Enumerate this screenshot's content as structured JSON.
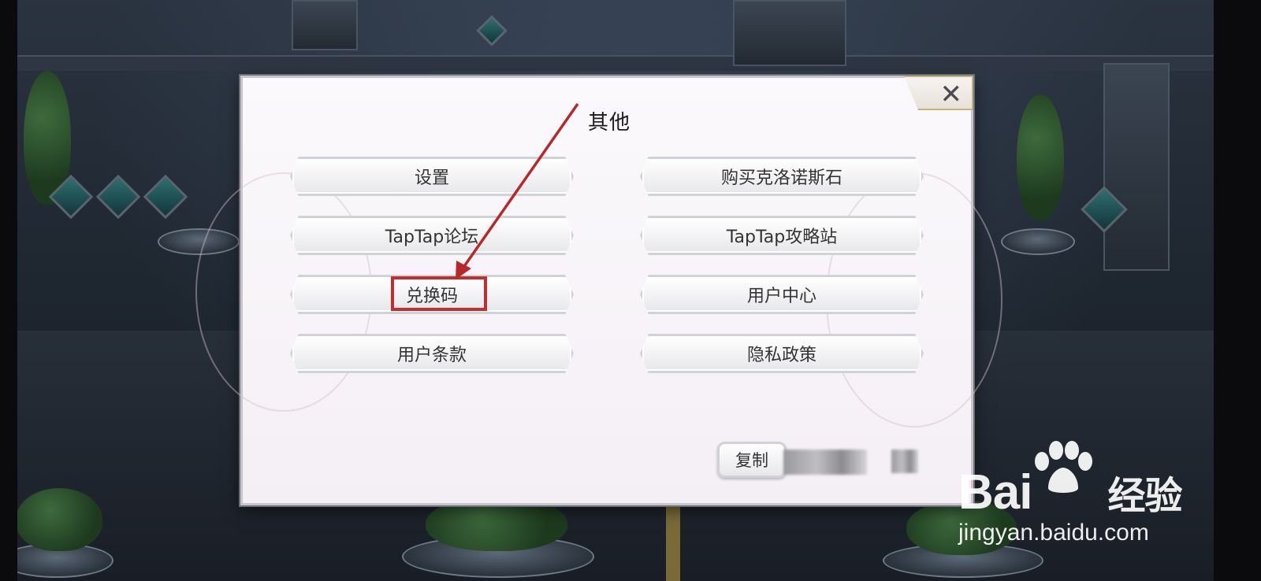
{
  "dialog": {
    "title": "其他",
    "close_icon": "close-icon",
    "buttons_left": [
      {
        "label": "设置"
      },
      {
        "label": "TapTap论坛"
      },
      {
        "label": "兑换码"
      },
      {
        "label": "用户条款"
      }
    ],
    "buttons_right": [
      {
        "label": "购买克洛诺斯石"
      },
      {
        "label": "TapTap攻略站"
      },
      {
        "label": "用户中心"
      },
      {
        "label": "隐私政策"
      }
    ],
    "copy_label": "复制"
  },
  "annotation": {
    "highlight_color": "#c32d2d",
    "arrow_color": "#b82828"
  },
  "watermark": {
    "brand": "Bai",
    "brand_suffix": "经验",
    "url": "jingyan.baidu.com"
  }
}
